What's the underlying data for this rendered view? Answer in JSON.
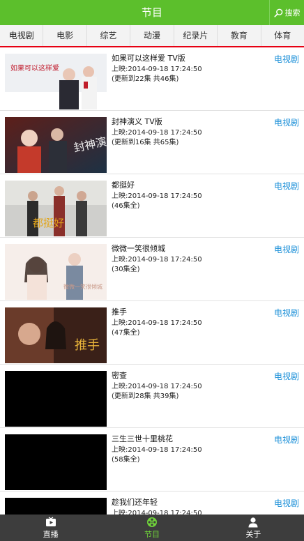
{
  "header": {
    "title": "节目",
    "search_label": "搜索"
  },
  "tabs": [
    {
      "label": "电视剧"
    },
    {
      "label": "电影"
    },
    {
      "label": "综艺"
    },
    {
      "label": "动漫"
    },
    {
      "label": "纪录片"
    },
    {
      "label": "教育"
    },
    {
      "label": "体育"
    }
  ],
  "programs": [
    {
      "title": "如果可以这样爱 TV版",
      "date": "上映:2014-09-18 17:24:50",
      "episodes": "(更新到22集  共46集)",
      "category": "电视剧",
      "thumb_text": "如果可以这样爱"
    },
    {
      "title": "封神演义 TV版",
      "date": "上映:2014-09-18 17:24:50",
      "episodes": "(更新到16集  共65集)",
      "category": "电视剧",
      "thumb_text": "封神演义"
    },
    {
      "title": "都挺好",
      "date": "上映:2014-09-18 17:24:50",
      "episodes": "(46集全)",
      "category": "电视剧",
      "thumb_text": "都挺好"
    },
    {
      "title": "微微一笑很倾城",
      "date": "上映:2014-09-18 17:24:50",
      "episodes": "(30集全)",
      "category": "电视剧",
      "thumb_text": "微微一笑很倾城"
    },
    {
      "title": "推手",
      "date": "上映:2014-09-18 17:24:50",
      "episodes": "(47集全)",
      "category": "电视剧",
      "thumb_text": "推手"
    },
    {
      "title": "密查",
      "date": "上映:2014-09-18 17:24:50",
      "episodes": "(更新到28集  共39集)",
      "category": "电视剧"
    },
    {
      "title": "三生三世十里桃花",
      "date": "上映:2014-09-18 17:24:50",
      "episodes": "(58集全)",
      "category": "电视剧"
    },
    {
      "title": "趁我们还年轻",
      "date": "上映:2014-09-18 17:24:50",
      "episodes": "",
      "category": "电视剧"
    }
  ],
  "bottom_nav": [
    {
      "label": "直播",
      "icon": "tv-play-icon"
    },
    {
      "label": "节目",
      "icon": "film-reel-icon"
    },
    {
      "label": "关于",
      "icon": "user-icon"
    }
  ],
  "colors": {
    "header": "#5cbf2c",
    "tab_indicator": "#e60012",
    "category": "#1a8fd8",
    "nav_bg": "#3d3d3d",
    "nav_active": "#6fd23a"
  }
}
